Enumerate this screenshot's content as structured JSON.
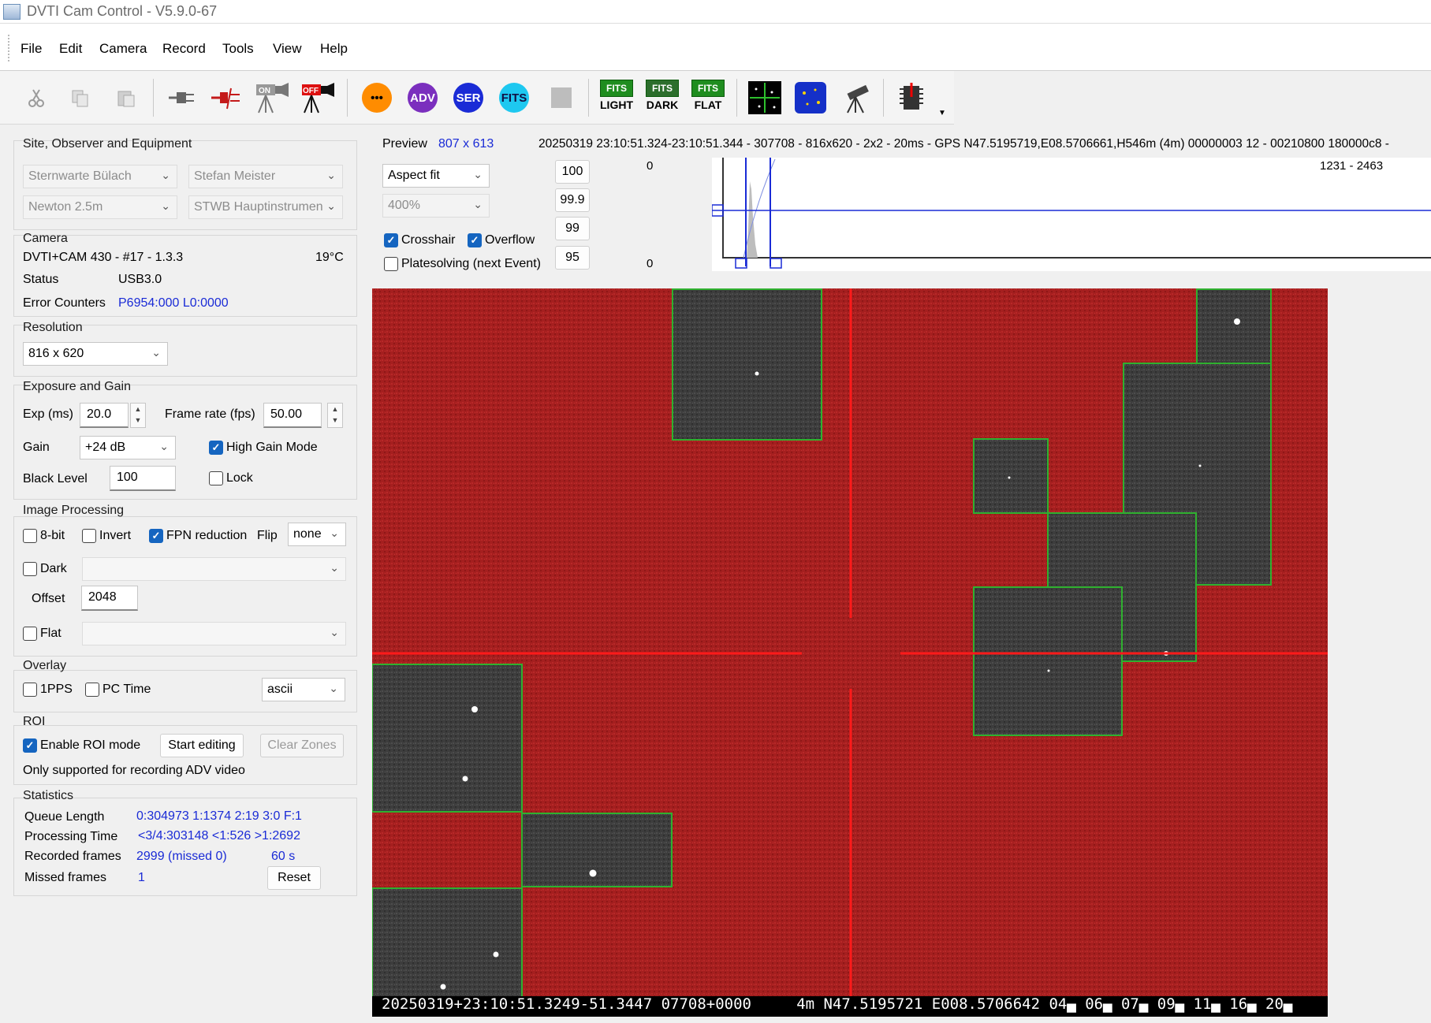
{
  "window": {
    "title": "DVTI Cam Control - V5.9.0-67"
  },
  "menu": [
    "File",
    "Edit",
    "Camera",
    "Record",
    "Tools",
    "View",
    "Help"
  ],
  "toolbar": {
    "cut_icon": "scissors-icon",
    "adv": "ADV",
    "ser": "SER",
    "fits": "FITS",
    "dots": "•••",
    "fits_light": {
      "top": "FITS",
      "bottom": "LIGHT"
    },
    "fits_dark": {
      "top": "FITS",
      "bottom": "DARK"
    },
    "fits_flat": {
      "top": "FITS",
      "bottom": "FLAT"
    },
    "on_label": "ON",
    "off_label": "OFF"
  },
  "site": {
    "title": "Site, Observer and Equipment",
    "site": "Sternwarte Bülach",
    "observer": "Stefan Meister",
    "telescope": "Newton 2.5m",
    "instrument": "STWB Hauptinstrumen"
  },
  "camera": {
    "title": "Camera",
    "model": "DVTI+CAM 430  -  #17  -  1.3.3",
    "temp": "19°C",
    "status_label": "Status",
    "status_value": "USB3.0",
    "errors_label": "Error Counters",
    "errors_value": "P6954:000 L0:0000"
  },
  "resolution": {
    "title": "Resolution",
    "value": "816 x 620"
  },
  "exposure": {
    "title": "Exposure and Gain",
    "exp_label": "Exp (ms)",
    "exp_value": "20.0",
    "fps_label": "Frame rate (fps)",
    "fps_value": "50.00",
    "gain_label": "Gain",
    "gain_value": "+24 dB",
    "high_gain_label": "High Gain Mode",
    "high_gain": true,
    "black_label": "Black Level",
    "black_value": "100",
    "lock_label": "Lock",
    "lock": false
  },
  "processing": {
    "title": "Image Processing",
    "bit8_label": "8-bit",
    "invert_label": "Invert",
    "fpn_label": "FPN reduction",
    "fpn": true,
    "flip_label": "Flip",
    "flip_value": "none",
    "dark_label": "Dark",
    "offset_label": "Offset",
    "offset_value": "2048",
    "flat_label": "Flat"
  },
  "overlay": {
    "title": "Overlay",
    "pps_label": "1PPS",
    "pctime_label": "PC Time",
    "format": "ascii"
  },
  "roi": {
    "title": "ROI",
    "enable_label": "Enable ROI mode",
    "enabled": true,
    "start_label": "Start editing",
    "clear_label": "Clear Zones",
    "note": "Only supported for recording ADV video"
  },
  "stats": {
    "title": "Statistics",
    "queue_label": "Queue Length",
    "queue_value": "0:304973  1:1374  2:19  3:0  F:1",
    "proc_label": "Processing Time",
    "proc_value": "<3/4:303148  <1:526   >1:2692",
    "rec_label": "Recorded frames",
    "rec_value": "2999 (missed 0)",
    "rec_time": "60 s",
    "missed_label": "Missed frames",
    "missed_value": "1",
    "reset_label": "Reset"
  },
  "preview": {
    "label": "Preview",
    "size": "807 x 613",
    "info": "20250319 23:10:51.324-23:10:51.344 - 307708 - 816x620 - 2x2 - 20ms - GPS N47.5195719,E08.5706661,H546m (4m) 00000003 12 - 00210800 180000c8 -",
    "fit_mode": "Aspect fit",
    "zoom": "400%",
    "crosshair_label": "Crosshair",
    "crosshair": true,
    "overflow_label": "Overflow",
    "overflow": true,
    "platesolve_label": "Platesolving (next Event)",
    "platesolve": false,
    "stretch": [
      "100",
      "99.9",
      "99",
      "95"
    ],
    "hist_top": "0",
    "hist_bottom": "0",
    "hist_range": "1231 - 2463",
    "overlay_text": "20250319+23:10:51.3249-51.3447 07708+0000     4m N47.5195721 E008.5706642 04▄ 06▄ 07▄ 09▄ 11▄ 16▄ 20▄"
  },
  "colors": {
    "accent_blue": "#1a2bd6",
    "image_red": "#a51f1f",
    "roi_gray": "#3d3d3d",
    "roi_border": "#2fb02f",
    "crosshair": "#ff1a1a"
  }
}
